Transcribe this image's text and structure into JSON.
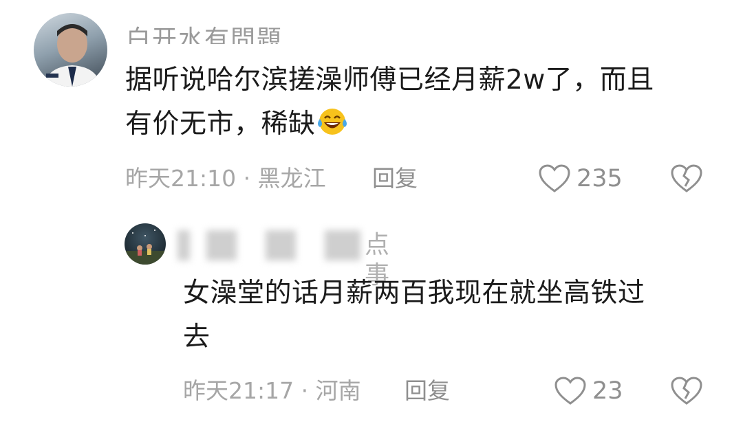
{
  "comments": [
    {
      "username": "白开水有問題",
      "text_line1": "据听说哈尔滨搓澡师傅已经月薪2w了，而且",
      "text_line2": "有价无市，稀缺",
      "emoji_icon": "laughing-tears-icon",
      "meta": "昨天21:10 · 黑龙江",
      "reply_label": "回复",
      "likes": "235"
    },
    {
      "username_visible": "点事",
      "text_line1": "女澡堂的话月薪两百我现在就坐高铁过",
      "text_line2": "去",
      "meta": "昨天21:17 · 河南",
      "reply_label": "回复",
      "likes": "23"
    }
  ]
}
